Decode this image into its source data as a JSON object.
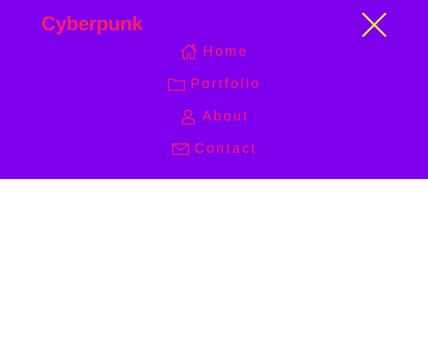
{
  "brand": {
    "name": "Cyberpunk"
  },
  "colors": {
    "panel_bg": "#7f00ed",
    "accent": "#ff1d6b",
    "close": "#e6f03b",
    "page_bg": "#ffffff"
  },
  "close_icon": "close-icon",
  "menu": {
    "items": [
      {
        "label": "Home",
        "icon": "home-icon"
      },
      {
        "label": "Portfolio",
        "icon": "folder-icon"
      },
      {
        "label": "About",
        "icon": "user-icon"
      },
      {
        "label": "Contact",
        "icon": "envelope-icon"
      }
    ]
  }
}
